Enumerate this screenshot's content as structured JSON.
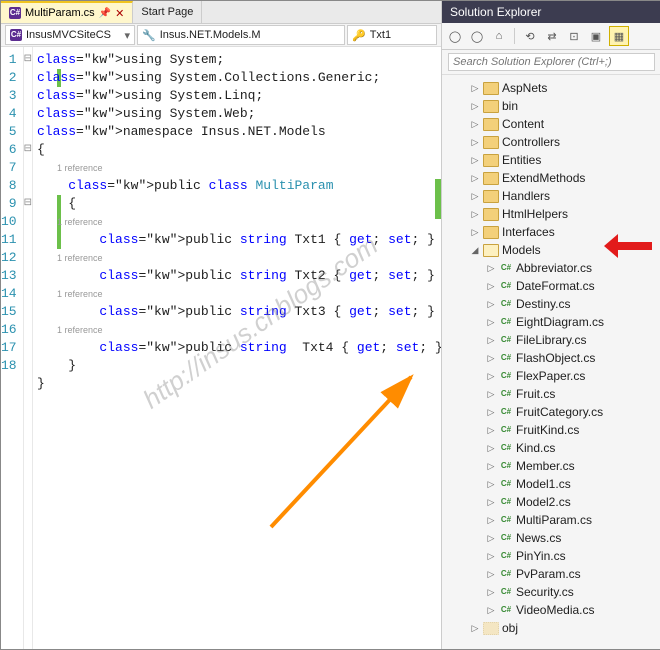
{
  "tabs": {
    "active_file": "MultiParam.cs",
    "start_page": "Start Page"
  },
  "nav": {
    "project": "InsusMVCSiteCS",
    "namespace": "Insus.NET.Models.M",
    "member": "Txt1"
  },
  "code": {
    "lines": [
      {
        "n": 1,
        "fold": "⊟",
        "txt": "using System;",
        "cls": [
          "kw",
          "",
          "pn"
        ]
      },
      {
        "n": 2,
        "fold": "",
        "txt": "using System.Collections.Generic;"
      },
      {
        "n": 3,
        "fold": "",
        "txt": "using System.Linq;"
      },
      {
        "n": 4,
        "fold": "",
        "txt": "using System.Web;"
      },
      {
        "n": 5,
        "fold": "",
        "txt": ""
      },
      {
        "n": 6,
        "fold": "⊟",
        "txt": "namespace Insus.NET.Models"
      },
      {
        "n": 7,
        "fold": "",
        "txt": "{"
      },
      {
        "n": "",
        "fold": "",
        "ref": "1 reference"
      },
      {
        "n": 8,
        "fold": "⊟",
        "txt": "    public class MultiParam"
      },
      {
        "n": 9,
        "fold": "",
        "txt": "    {"
      },
      {
        "n": "",
        "fold": "",
        "ref": "1 reference"
      },
      {
        "n": 10,
        "fold": "",
        "txt": "        public string Txt1 { get; set; }"
      },
      {
        "n": 11,
        "fold": "",
        "txt": ""
      },
      {
        "n": "",
        "fold": "",
        "ref": "1 reference"
      },
      {
        "n": 12,
        "fold": "",
        "txt": "        public string Txt2 { get; set; }"
      },
      {
        "n": 13,
        "fold": "",
        "txt": ""
      },
      {
        "n": "",
        "fold": "",
        "ref": "1 reference"
      },
      {
        "n": 14,
        "fold": "",
        "txt": "        public string Txt3 { get; set; }"
      },
      {
        "n": 15,
        "fold": "",
        "txt": ""
      },
      {
        "n": "",
        "fold": "",
        "ref": "1 reference"
      },
      {
        "n": 16,
        "fold": "",
        "txt": "        public string  Txt4 { get; set; }"
      },
      {
        "n": 17,
        "fold": "",
        "txt": "    }"
      },
      {
        "n": 18,
        "fold": "",
        "txt": "}"
      }
    ]
  },
  "solution_explorer": {
    "title": "Solution Explorer",
    "search_placeholder": "Search Solution Explorer (Ctrl+;)",
    "folders": [
      "AspNets",
      "bin",
      "Content",
      "Controllers",
      "Entities",
      "ExtendMethods",
      "Handlers",
      "HtmlHelpers",
      "Interfaces"
    ],
    "models_label": "Models",
    "model_files": [
      "Abbreviator.cs",
      "DateFormat.cs",
      "Destiny.cs",
      "EightDiagram.cs",
      "FileLibrary.cs",
      "FlashObject.cs",
      "FlexPaper.cs",
      "Fruit.cs",
      "FruitCategory.cs",
      "FruitKind.cs",
      "Kind.cs",
      "Member.cs",
      "Model1.cs",
      "Model2.cs",
      "MultiParam.cs",
      "News.cs",
      "PinYin.cs",
      "PvParam.cs",
      "Security.cs",
      "VideoMedia.cs"
    ],
    "after_folders": [
      "obj"
    ]
  },
  "watermark": "http://insus.cnblogs.com"
}
